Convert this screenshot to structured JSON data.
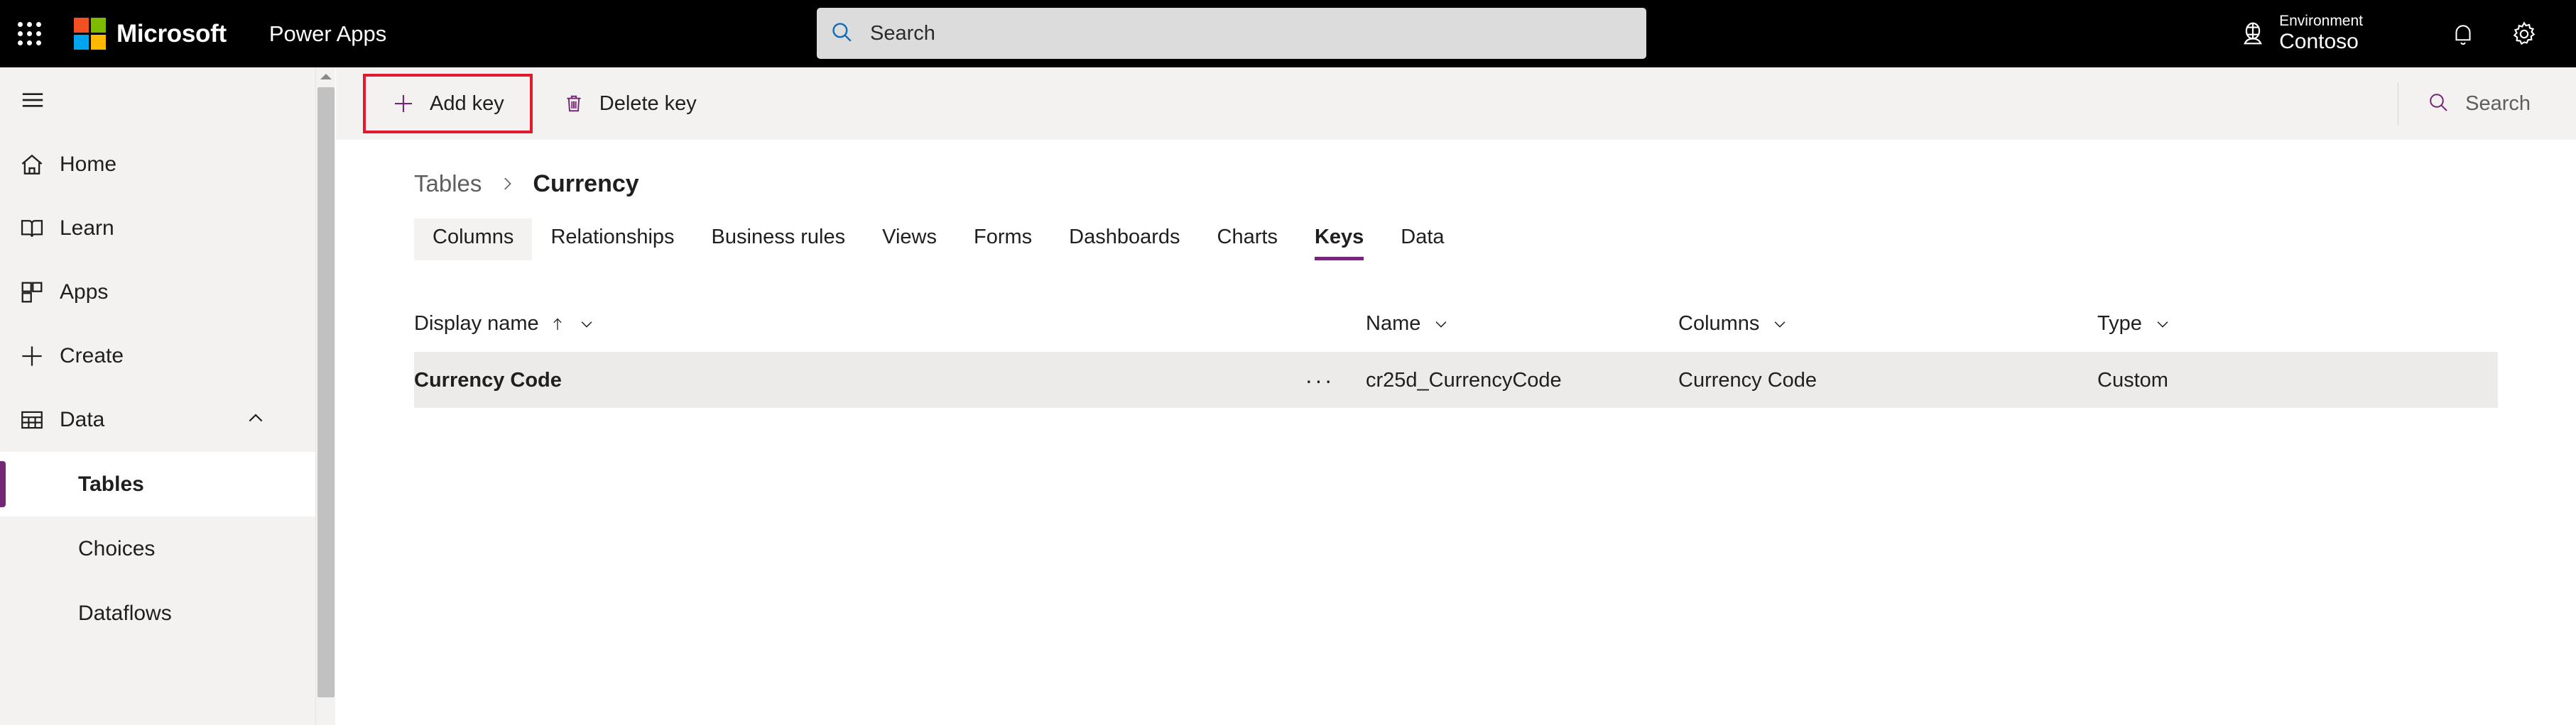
{
  "suite": {
    "waffle_icon": "app-launcher-waffle-icon",
    "brand": "Microsoft",
    "app_name": "Power Apps",
    "search": {
      "placeholder": "Search",
      "icon": "search-icon"
    },
    "environment": {
      "label": "Environment",
      "value": "Contoso",
      "icon": "globe-icon"
    },
    "notifications_icon": "bell-icon",
    "settings_icon": "gear-icon"
  },
  "sidebar": {
    "hamburger_icon": "hamburger-menu-icon",
    "items": [
      {
        "label": "Home",
        "icon": "home-icon",
        "selected": false
      },
      {
        "label": "Learn",
        "icon": "book-icon",
        "selected": false
      },
      {
        "label": "Apps",
        "icon": "apps-grid-icon",
        "selected": false
      },
      {
        "label": "Create",
        "icon": "plus-icon",
        "selected": false
      },
      {
        "label": "Data",
        "icon": "table-grid-icon",
        "selected": false,
        "expanded": true,
        "chevron": "chevron-up-icon"
      }
    ],
    "subitems": [
      {
        "label": "Tables",
        "selected": true
      },
      {
        "label": "Choices",
        "selected": false
      },
      {
        "label": "Dataflows",
        "selected": false
      }
    ]
  },
  "command_bar": {
    "add_key": {
      "label": "Add key",
      "icon": "plus-icon",
      "highlighted": true
    },
    "delete_key": {
      "label": "Delete key",
      "icon": "trash-icon"
    },
    "search": {
      "label": "Search",
      "icon": "search-icon"
    }
  },
  "breadcrumb": {
    "root": "Tables",
    "separator_icon": "chevron-right-icon",
    "current": "Currency"
  },
  "tabs": [
    {
      "label": "Columns",
      "state": "hovered"
    },
    {
      "label": "Relationships",
      "state": "normal"
    },
    {
      "label": "Business rules",
      "state": "normal"
    },
    {
      "label": "Views",
      "state": "normal"
    },
    {
      "label": "Forms",
      "state": "normal"
    },
    {
      "label": "Dashboards",
      "state": "normal"
    },
    {
      "label": "Charts",
      "state": "normal"
    },
    {
      "label": "Keys",
      "state": "active"
    },
    {
      "label": "Data",
      "state": "normal"
    }
  ],
  "grid": {
    "columns": [
      {
        "label": "Display name",
        "sort": "ascending",
        "sort_icon": "arrow-up-icon",
        "menu_icon": "chevron-down-icon"
      },
      {
        "label": "Name",
        "sort": "none",
        "menu_icon": "chevron-down-icon"
      },
      {
        "label": "Columns",
        "sort": "none",
        "menu_icon": "chevron-down-icon"
      },
      {
        "label": "Type",
        "sort": "none",
        "menu_icon": "chevron-down-icon"
      }
    ],
    "rows": [
      {
        "display_name": "Currency Code",
        "overflow_icon": "ellipsis-icon",
        "overflow_label": "···",
        "name": "cr25d_CurrencyCode",
        "columns": "Currency Code",
        "type": "Custom"
      }
    ]
  },
  "colors": {
    "accent_purple": "#742774",
    "highlight_red": "#e2192f",
    "suite_bar": "#000000",
    "nav_background": "#f3f2f1",
    "row_background": "#edebe9"
  }
}
